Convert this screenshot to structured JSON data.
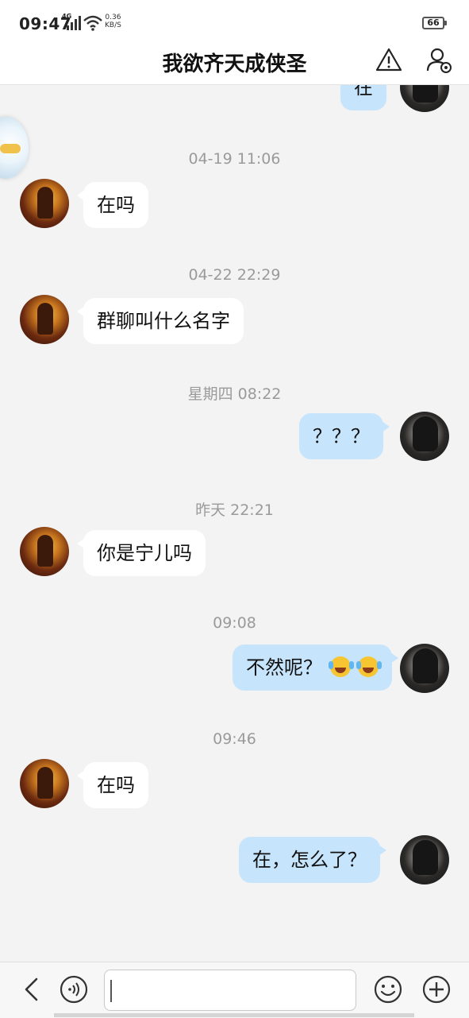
{
  "status_bar": {
    "time": "09:47",
    "network": "4G",
    "speed_value": "0.36",
    "speed_unit": "KB/S",
    "battery": "66",
    "icons": [
      "signal-4g-icon",
      "wifi-icon",
      "battery-icon"
    ]
  },
  "header": {
    "title": "我欲齐天成侠圣",
    "icons": [
      "warning-icon",
      "profile-settings-icon"
    ]
  },
  "messages": [
    {
      "side": "right",
      "text": "在",
      "partially_visible": true
    },
    {
      "timestamp": "04-19 11:06"
    },
    {
      "side": "left",
      "text": "在吗"
    },
    {
      "timestamp": "04-22 22:29"
    },
    {
      "side": "left",
      "text": "群聊叫什么名字"
    },
    {
      "timestamp": "星期四 08:22"
    },
    {
      "side": "right",
      "text": "？？？"
    },
    {
      "timestamp": "昨天 22:21"
    },
    {
      "side": "left",
      "text": "你是宁儿吗"
    },
    {
      "timestamp": "09:08"
    },
    {
      "side": "right",
      "text": "不然呢？",
      "emoji": [
        "tears-of-joy-emoji",
        "tears-of-joy-emoji"
      ]
    },
    {
      "timestamp": "09:46"
    },
    {
      "side": "left",
      "text": "在吗"
    },
    {
      "side": "right",
      "text": "在，怎么了？"
    }
  ],
  "input_bar": {
    "value": "",
    "icons": [
      "back-chevron-icon",
      "voice-icon",
      "emoji-face-icon",
      "plus-icon"
    ]
  },
  "colors": {
    "background": "#f3f3f4",
    "incoming_bubble": "#ffffff",
    "outgoing_bubble": "#c6e4fb",
    "timestamp": "#9a9a9a"
  }
}
